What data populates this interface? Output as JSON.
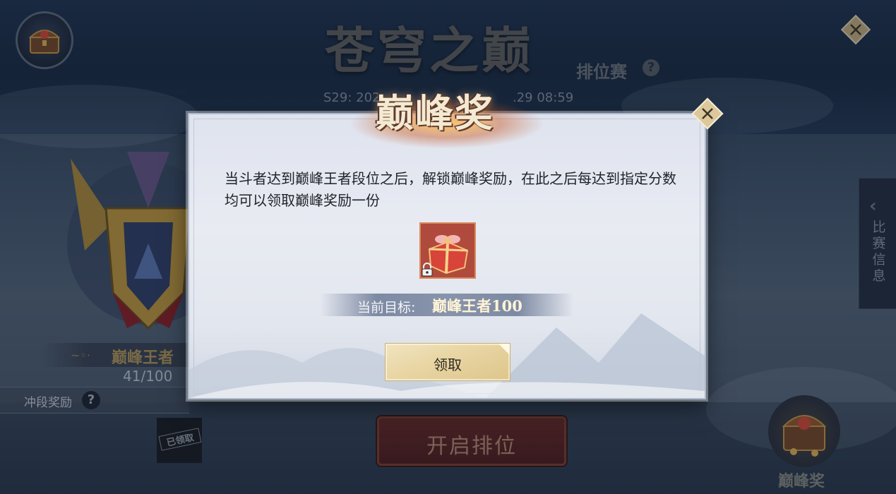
{
  "background": {
    "title": "苍穹之巅",
    "mode_label": "排位赛",
    "mode_help": "?",
    "season_start": "S29: 202",
    "season_end": ".29 08:59",
    "rank_name": "巅峰王者",
    "rank_score": "41/100",
    "reward_label": "冲段奖励",
    "reward_help": "?",
    "claimed_stamp": "已领取",
    "start_button": "开启排位",
    "side_tab_label": "比赛信息",
    "peak_reward_label": "巅峰奖"
  },
  "modal": {
    "title": "巅峰奖",
    "description": "当斗者达到巅峰王者段位之后，解锁巅峰奖励，在此之后每达到指定分数均可以领取巅峰奖励一份",
    "reward_icon": "gift-box-icon",
    "locked": true,
    "target_label": "当前目标:",
    "target_value": "巅峰王者100",
    "claim_button": "领取"
  },
  "colors": {
    "modal_bg": "#e4e7ef",
    "claim_button": "#e8d5a3",
    "start_button": "#5e2626",
    "title_gold": "#f4ead2"
  }
}
